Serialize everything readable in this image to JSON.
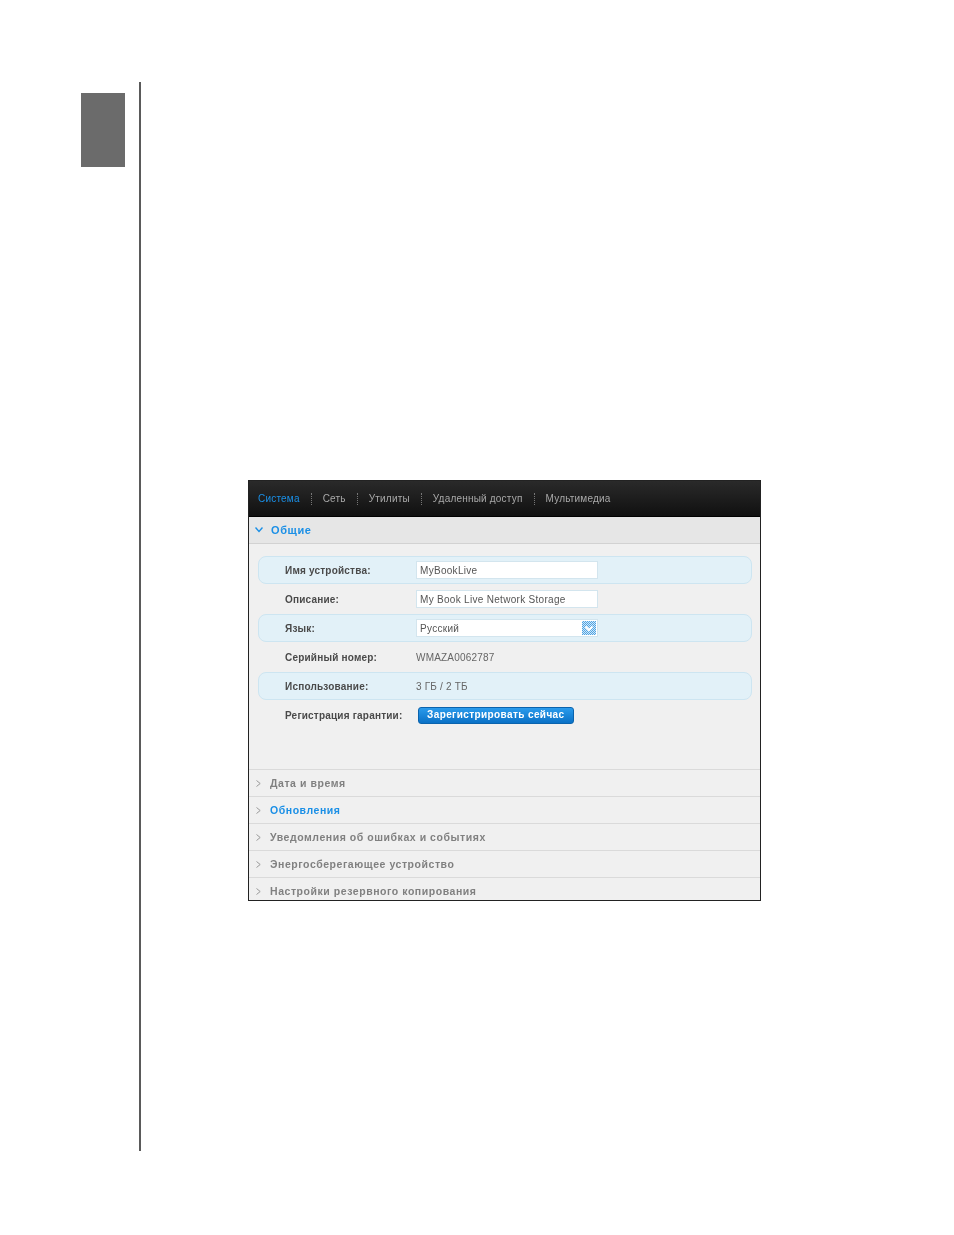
{
  "nav_tabs": [
    {
      "label": "Система",
      "selected": true
    },
    {
      "label": "Сеть",
      "selected": false
    },
    {
      "label": "Утилиты",
      "selected": false
    },
    {
      "label": "Удаленный доступ",
      "selected": false
    },
    {
      "label": "Мультимедиа",
      "selected": false
    }
  ],
  "sections": [
    {
      "title": "Общие",
      "expanded": true,
      "highlighted": true,
      "fields": [
        {
          "kind": "input",
          "label": "Имя устройства:",
          "value": "MyBookLive"
        },
        {
          "kind": "input",
          "label": "Описание:",
          "value": "My Book Live Network Storage"
        },
        {
          "kind": "select",
          "label": "Язык:",
          "value": "Русский"
        },
        {
          "kind": "text",
          "label": "Серийный номер:",
          "value": "WMAZA0062787"
        },
        {
          "kind": "text",
          "label": "Использование:",
          "value": "3 ГБ / 2 ТБ"
        },
        {
          "kind": "button",
          "label": "Регистрация гарантии:",
          "button": "Зарегистрировать сейчас"
        }
      ]
    },
    {
      "title": "Дата и время",
      "expanded": false,
      "highlighted": false
    },
    {
      "title": "Обновления",
      "expanded": false,
      "highlighted": true
    },
    {
      "title": "Уведомления об ошибках и событиях",
      "expanded": false,
      "highlighted": false
    },
    {
      "title": "Энергосберегающее устройство",
      "expanded": false,
      "highlighted": false
    },
    {
      "title": "Настройки резервного копирования",
      "expanded": false,
      "highlighted": false
    }
  ]
}
